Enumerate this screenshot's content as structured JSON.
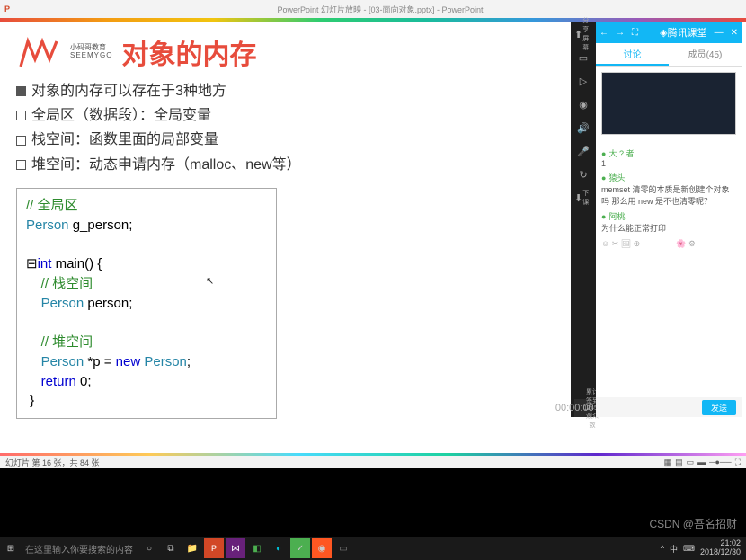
{
  "window": {
    "app": "P",
    "title": "PowerPoint 幻灯片放映 - [03-面向对象.pptx] - PowerPoint"
  },
  "logo": {
    "line1": "小码哥教育",
    "line2": "SEEMYGO"
  },
  "slide": {
    "title": "对象的内存",
    "bullets": [
      "对象的内存可以存在于3种地方",
      "全局区（数据段）：全局变量",
      "栈空间：函数里面的局部变量",
      "堆空间：动态申请内存（malloc、new等）"
    ]
  },
  "code": {
    "l1c": "// 全局区",
    "l2a": "Person",
    "l2b": " g_person;",
    "l3a": "int",
    "l3b": " main() {",
    "l4c": "// 栈空间",
    "l5a": "Person",
    "l5b": " person;",
    "l6c": "// 堆空间",
    "l7a": "Person",
    "l7b": " *p = ",
    "l7c": "new",
    "l7d": " Person",
    "l7e": ";",
    "l8a": "return",
    "l8b": " 0;",
    "l9": "}"
  },
  "status": {
    "left": "幻灯片 第 16 张，共 84 张"
  },
  "panel": {
    "brand": "腾讯课堂",
    "tabs": {
      "t1": "讨论",
      "t2": "成员(45)"
    },
    "chat": {
      "u1": "大 ? 者",
      "m1": "1",
      "u2": "猿头",
      "m2": "memset 清零的本质是新创建个对象吗 那么用 new 是不也清零呢？",
      "u3": "阿桃",
      "m3": "为什么能正常打印"
    },
    "sendBtn": "发送",
    "timer": "00:00:00",
    "count": "累计签到\n12450\n观众数"
  },
  "taskbar": {
    "search": "在这里输入你要搜索的内容",
    "time": "21:02",
    "date": "2018/12/30"
  },
  "watermark": "CSDN @吾名招财"
}
